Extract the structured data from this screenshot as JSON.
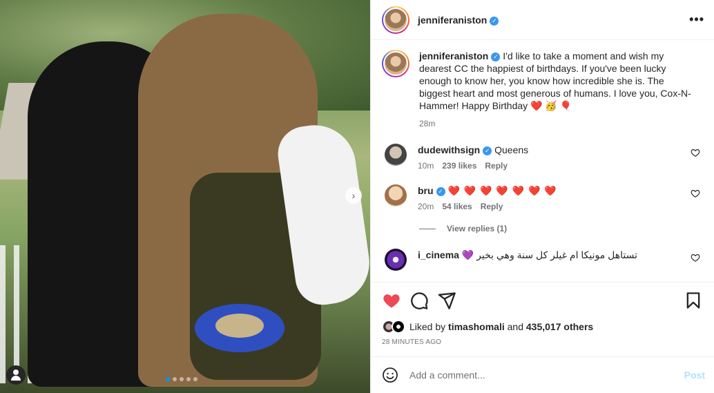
{
  "post": {
    "username": "jenniferaniston",
    "verified": true
  },
  "caption": {
    "username": "jenniferaniston",
    "text": "I'd like to take a moment and wish my dearest CC the happiest of birthdays. If you've been lucky enough to know her, you know how incredible she is. The biggest heart and most generous of humans. I love you, Cox-N-Hammer! Happy Birthday ❤️ 🥳 🎈",
    "time": "28m"
  },
  "comments": [
    {
      "username": "dudewithsign",
      "verified": true,
      "text": "Queens",
      "time": "10m",
      "likes": "239 likes",
      "reply": "Reply"
    },
    {
      "username": "bru",
      "verified": true,
      "text": "❤️ ❤️ ❤️ ❤️ ❤️ ❤️ ❤️",
      "time": "20m",
      "likes": "54 likes",
      "reply": "Reply"
    },
    {
      "username": "i_cinema",
      "verified": false,
      "text": "💜 تستاهل مونيكا ام غيلر كل سنة وهي بخير"
    }
  ],
  "view_replies": "View replies (1)",
  "likes": {
    "prefix": "Liked by",
    "user": "timashomali",
    "connector": "and",
    "others": "435,017 others"
  },
  "time_ago": "28 MINUTES AGO",
  "comment_box": {
    "placeholder": "Add a comment...",
    "post_label": "Post"
  },
  "carousel": {
    "count": 5,
    "active": 0
  },
  "colors": {
    "like_red": "#ed4956",
    "verified_blue": "#3897f0",
    "post_disabled": "#b2dffc"
  }
}
